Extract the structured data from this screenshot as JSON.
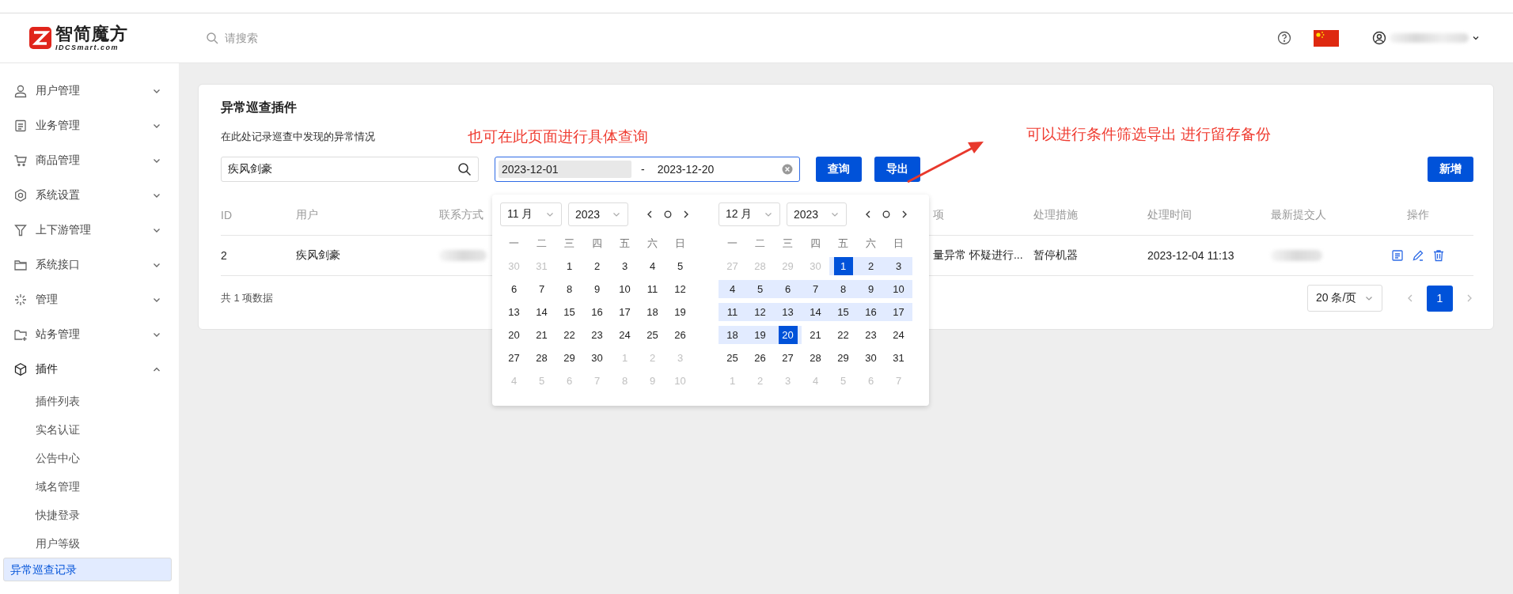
{
  "header": {
    "logo_text": "智简魔方",
    "logo_subtext": "IDCSmart.com",
    "search_placeholder": "请搜索"
  },
  "sidebar": {
    "items": [
      {
        "label": "用户管理",
        "expanded": false
      },
      {
        "label": "业务管理",
        "expanded": false
      },
      {
        "label": "商品管理",
        "expanded": false
      },
      {
        "label": "系统设置",
        "expanded": false
      },
      {
        "label": "上下游管理",
        "expanded": false
      },
      {
        "label": "系统接口",
        "expanded": false
      },
      {
        "label": "管理",
        "expanded": false
      },
      {
        "label": "站务管理",
        "expanded": false
      },
      {
        "label": "插件",
        "expanded": true,
        "children": [
          {
            "label": "插件列表",
            "selected": false
          },
          {
            "label": "实名认证",
            "selected": false
          },
          {
            "label": "公告中心",
            "selected": false
          },
          {
            "label": "域名管理",
            "selected": false
          },
          {
            "label": "快捷登录",
            "selected": false
          },
          {
            "label": "用户等级",
            "selected": false
          },
          {
            "label": "异常巡查记录",
            "selected": true
          }
        ]
      }
    ]
  },
  "page": {
    "title": "异常巡查插件",
    "description": "在此处记录巡查中发现的异常情况",
    "search": {
      "value": "疾风剑豪"
    },
    "date_range": {
      "start": "2023-12-01",
      "separator": "-",
      "end": "2023-12-20"
    },
    "buttons": [
      {
        "label": "查询"
      },
      {
        "label": "导出"
      }
    ],
    "add_button": "新增",
    "table": {
      "columns": [
        "ID",
        "用户",
        "联系方式",
        "项",
        "处理措施",
        "处理时间",
        "最新提交人",
        "操作"
      ],
      "rows": [
        {
          "id": "2",
          "user": "疾风剑豪",
          "column_4": "量异常 怀疑进行...",
          "measure": "暂停机器",
          "time": "2023-12-04 11:13"
        }
      ]
    },
    "total": "共 1 项数据",
    "page_size": "20 条/页",
    "pages": [
      {
        "label": "1",
        "selected": true
      }
    ]
  },
  "date_picker": {
    "panels": [
      {
        "month": "11 月",
        "year": "2023",
        "weekdays": [
          "一",
          "二",
          "三",
          "四",
          "五",
          "六",
          "日"
        ],
        "weeks": [
          [
            {
              "d": "30",
              "muted": true,
              "in_range": false,
              "selected": false
            },
            {
              "d": "31",
              "muted": true,
              "in_range": false,
              "selected": false
            },
            {
              "d": "1",
              "muted": false,
              "in_range": false,
              "selected": false
            },
            {
              "d": "2",
              "muted": false,
              "in_range": false,
              "selected": false
            },
            {
              "d": "3",
              "muted": false,
              "in_range": false,
              "selected": false
            },
            {
              "d": "4",
              "muted": false,
              "in_range": false,
              "selected": false
            },
            {
              "d": "5",
              "muted": false,
              "in_range": false,
              "selected": false
            }
          ],
          [
            {
              "d": "6",
              "muted": false,
              "in_range": false,
              "selected": false
            },
            {
              "d": "7",
              "muted": false,
              "in_range": false,
              "selected": false
            },
            {
              "d": "8",
              "muted": false,
              "in_range": false,
              "selected": false
            },
            {
              "d": "9",
              "muted": false,
              "in_range": false,
              "selected": false
            },
            {
              "d": "10",
              "muted": false,
              "in_range": false,
              "selected": false
            },
            {
              "d": "11",
              "muted": false,
              "in_range": false,
              "selected": false
            },
            {
              "d": "12",
              "muted": false,
              "in_range": false,
              "selected": false
            }
          ],
          [
            {
              "d": "13",
              "muted": false,
              "in_range": false,
              "selected": false
            },
            {
              "d": "14",
              "muted": false,
              "in_range": false,
              "selected": false
            },
            {
              "d": "15",
              "muted": false,
              "in_range": false,
              "selected": false
            },
            {
              "d": "16",
              "muted": false,
              "in_range": false,
              "selected": false
            },
            {
              "d": "17",
              "muted": false,
              "in_range": false,
              "selected": false
            },
            {
              "d": "18",
              "muted": false,
              "in_range": false,
              "selected": false
            },
            {
              "d": "19",
              "muted": false,
              "in_range": false,
              "selected": false
            }
          ],
          [
            {
              "d": "20",
              "muted": false,
              "in_range": false,
              "selected": false
            },
            {
              "d": "21",
              "muted": false,
              "in_range": false,
              "selected": false
            },
            {
              "d": "22",
              "muted": false,
              "in_range": false,
              "selected": false
            },
            {
              "d": "23",
              "muted": false,
              "in_range": false,
              "selected": false
            },
            {
              "d": "24",
              "muted": false,
              "in_range": false,
              "selected": false
            },
            {
              "d": "25",
              "muted": false,
              "in_range": false,
              "selected": false
            },
            {
              "d": "26",
              "muted": false,
              "in_range": false,
              "selected": false
            }
          ],
          [
            {
              "d": "27",
              "muted": false,
              "in_range": false,
              "selected": false
            },
            {
              "d": "28",
              "muted": false,
              "in_range": false,
              "selected": false
            },
            {
              "d": "29",
              "muted": false,
              "in_range": false,
              "selected": false
            },
            {
              "d": "30",
              "muted": false,
              "in_range": false,
              "selected": false
            },
            {
              "d": "1",
              "muted": true,
              "in_range": false,
              "selected": false
            },
            {
              "d": "2",
              "muted": true,
              "in_range": false,
              "selected": false
            },
            {
              "d": "3",
              "muted": true,
              "in_range": false,
              "selected": false
            }
          ],
          [
            {
              "d": "4",
              "muted": true,
              "in_range": false,
              "selected": false
            },
            {
              "d": "5",
              "muted": true,
              "in_range": false,
              "selected": false
            },
            {
              "d": "6",
              "muted": true,
              "in_range": false,
              "selected": false
            },
            {
              "d": "7",
              "muted": true,
              "in_range": false,
              "selected": false
            },
            {
              "d": "8",
              "muted": true,
              "in_range": false,
              "selected": false
            },
            {
              "d": "9",
              "muted": true,
              "in_range": false,
              "selected": false
            },
            {
              "d": "10",
              "muted": true,
              "in_range": false,
              "selected": false
            }
          ]
        ]
      },
      {
        "month": "12 月",
        "year": "2023",
        "weekdays": [
          "一",
          "二",
          "三",
          "四",
          "五",
          "六",
          "日"
        ],
        "weeks": [
          [
            {
              "d": "27",
              "muted": true,
              "in_range": false,
              "selected": false
            },
            {
              "d": "28",
              "muted": true,
              "in_range": false,
              "selected": false
            },
            {
              "d": "29",
              "muted": true,
              "in_range": false,
              "selected": false
            },
            {
              "d": "30",
              "muted": true,
              "in_range": false,
              "selected": false
            },
            {
              "d": "1",
              "muted": false,
              "in_range": true,
              "selected": true
            },
            {
              "d": "2",
              "muted": false,
              "in_range": true,
              "selected": false
            },
            {
              "d": "3",
              "muted": false,
              "in_range": true,
              "selected": false
            }
          ],
          [
            {
              "d": "4",
              "muted": false,
              "in_range": true,
              "selected": false
            },
            {
              "d": "5",
              "muted": false,
              "in_range": true,
              "selected": false
            },
            {
              "d": "6",
              "muted": false,
              "in_range": true,
              "selected": false
            },
            {
              "d": "7",
              "muted": false,
              "in_range": true,
              "selected": false
            },
            {
              "d": "8",
              "muted": false,
              "in_range": true,
              "selected": false
            },
            {
              "d": "9",
              "muted": false,
              "in_range": true,
              "selected": false
            },
            {
              "d": "10",
              "muted": false,
              "in_range": true,
              "selected": false
            }
          ],
          [
            {
              "d": "11",
              "muted": false,
              "in_range": true,
              "selected": false
            },
            {
              "d": "12",
              "muted": false,
              "in_range": true,
              "selected": false
            },
            {
              "d": "13",
              "muted": false,
              "in_range": true,
              "selected": false
            },
            {
              "d": "14",
              "muted": false,
              "in_range": true,
              "selected": false
            },
            {
              "d": "15",
              "muted": false,
              "in_range": true,
              "selected": false
            },
            {
              "d": "16",
              "muted": false,
              "in_range": true,
              "selected": false
            },
            {
              "d": "17",
              "muted": false,
              "in_range": true,
              "selected": false
            }
          ],
          [
            {
              "d": "18",
              "muted": false,
              "in_range": true,
              "selected": false
            },
            {
              "d": "19",
              "muted": false,
              "in_range": true,
              "selected": false
            },
            {
              "d": "20",
              "muted": false,
              "in_range": true,
              "selected": true
            },
            {
              "d": "21",
              "muted": false,
              "in_range": false,
              "selected": false
            },
            {
              "d": "22",
              "muted": false,
              "in_range": false,
              "selected": false
            },
            {
              "d": "23",
              "muted": false,
              "in_range": false,
              "selected": false
            },
            {
              "d": "24",
              "muted": false,
              "in_range": false,
              "selected": false
            }
          ],
          [
            {
              "d": "25",
              "muted": false,
              "in_range": false,
              "selected": false
            },
            {
              "d": "26",
              "muted": false,
              "in_range": false,
              "selected": false
            },
            {
              "d": "27",
              "muted": false,
              "in_range": false,
              "selected": false
            },
            {
              "d": "28",
              "muted": false,
              "in_range": false,
              "selected": false
            },
            {
              "d": "29",
              "muted": false,
              "in_range": false,
              "selected": false
            },
            {
              "d": "30",
              "muted": false,
              "in_range": false,
              "selected": false
            },
            {
              "d": "31",
              "muted": false,
              "in_range": false,
              "selected": false
            }
          ],
          [
            {
              "d": "1",
              "muted": true,
              "in_range": false,
              "selected": false
            },
            {
              "d": "2",
              "muted": true,
              "in_range": false,
              "selected": false
            },
            {
              "d": "3",
              "muted": true,
              "in_range": false,
              "selected": false
            },
            {
              "d": "4",
              "muted": true,
              "in_range": false,
              "selected": false
            },
            {
              "d": "5",
              "muted": true,
              "in_range": false,
              "selected": false
            },
            {
              "d": "6",
              "muted": true,
              "in_range": false,
              "selected": false
            },
            {
              "d": "7",
              "muted": true,
              "in_range": false,
              "selected": false
            }
          ]
        ]
      }
    ]
  },
  "annotations": [
    {
      "text": "也可在此页面进行具体查询"
    },
    {
      "text": "可以进行条件筛选导出 进行留存备份"
    }
  ]
}
